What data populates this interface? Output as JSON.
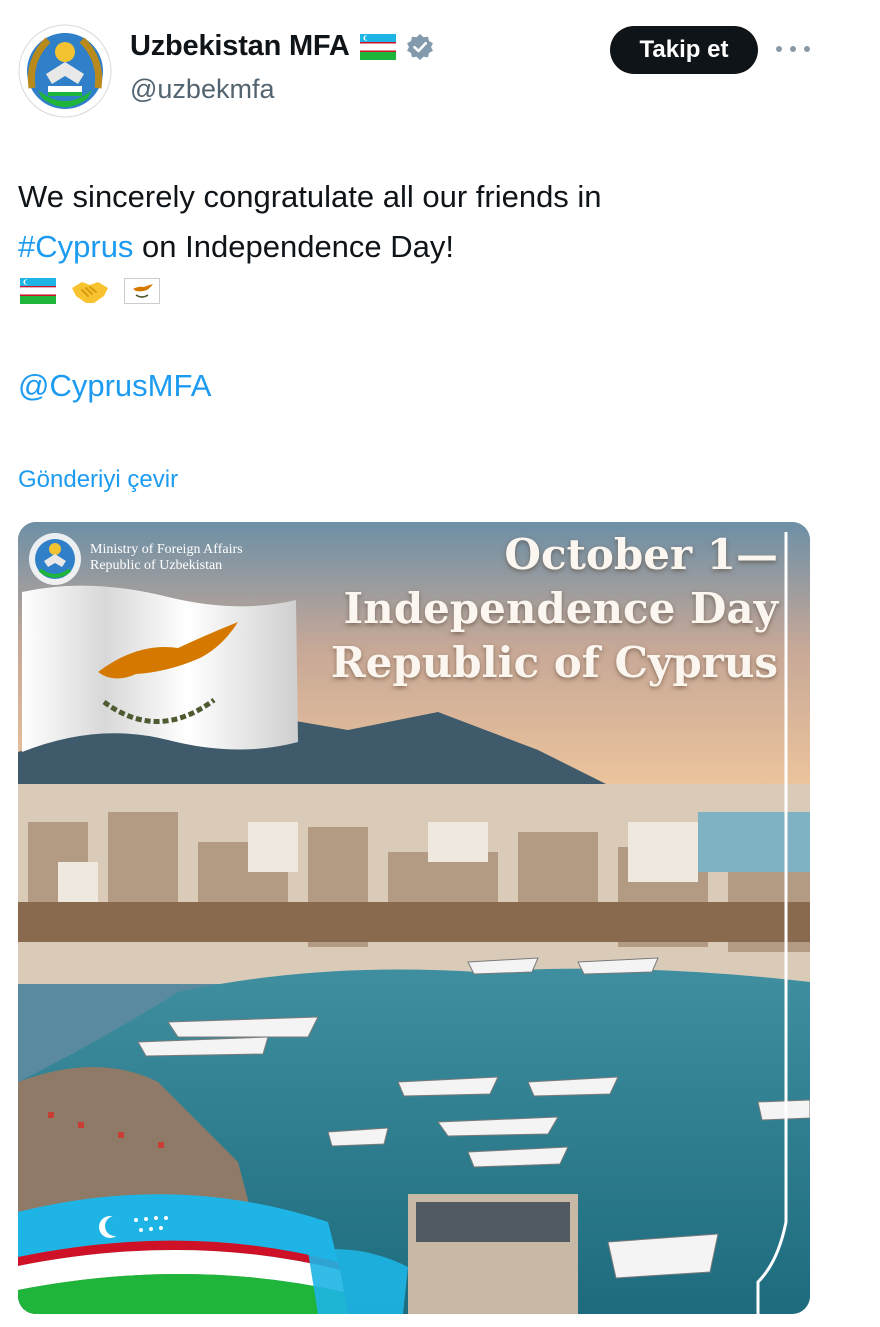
{
  "account": {
    "display_name": "Uzbekistan MFA",
    "handle": "@uzbekmfa",
    "verified": true,
    "avatar_icon": "uzbekistan-emblem-icon",
    "name_flag_icon": "uzbekistan-flag-icon"
  },
  "actions": {
    "follow_label": "Takip et",
    "more_icon": "more-horizontal-icon"
  },
  "tweet": {
    "text_line1": "We sincerely congratulate all our friends in",
    "hashtag": "#Cyprus",
    "text_line2_rest": " on Independence Day!",
    "emojis": [
      "uzbekistan-flag-icon",
      "handshake-icon",
      "cyprus-flag-icon"
    ],
    "mention": "@CyprusMFA",
    "translate_label": "Gönderiyi çevir"
  },
  "media": {
    "org_line1": "Ministry of Foreign Affairs",
    "org_line2": "Republic of Uzbekistan",
    "headline_line1": "October 1—",
    "headline_line2": "Independence Day",
    "headline_line3": "Republic of Cyprus"
  },
  "colors": {
    "link": "#1d9bf0",
    "text": "#0f1419",
    "secondary": "#536471",
    "button_bg": "#0f1419",
    "cyprus_copper": "#d57800",
    "uz_blue": "#1eb5e6",
    "uz_green": "#1eb53a"
  }
}
